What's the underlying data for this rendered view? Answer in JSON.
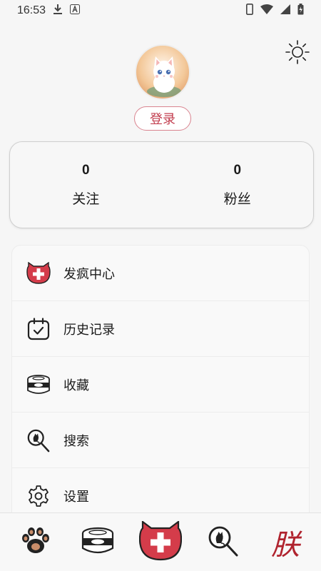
{
  "status_bar": {
    "time": "16:53"
  },
  "profile": {
    "login_label": "登录"
  },
  "stats": [
    {
      "count": "0",
      "label": "关注"
    },
    {
      "count": "0",
      "label": "粉丝"
    }
  ],
  "menu": [
    {
      "label": "发疯中心",
      "icon": "cat-cross-icon"
    },
    {
      "label": "历史记录",
      "icon": "calendar-check-icon"
    },
    {
      "label": "收藏",
      "icon": "can-icon"
    },
    {
      "label": "搜索",
      "icon": "cat-search-icon"
    },
    {
      "label": "设置",
      "icon": "gear-icon"
    }
  ],
  "tab_bar": {
    "items": [
      "paw-icon",
      "can-icon",
      "cat-cross-icon",
      "cat-search-icon",
      "zhen-glyph-icon"
    ],
    "zhen_glyph": "朕"
  },
  "colors": {
    "accent": "#d43c4a",
    "login_border": "#d9838f"
  }
}
